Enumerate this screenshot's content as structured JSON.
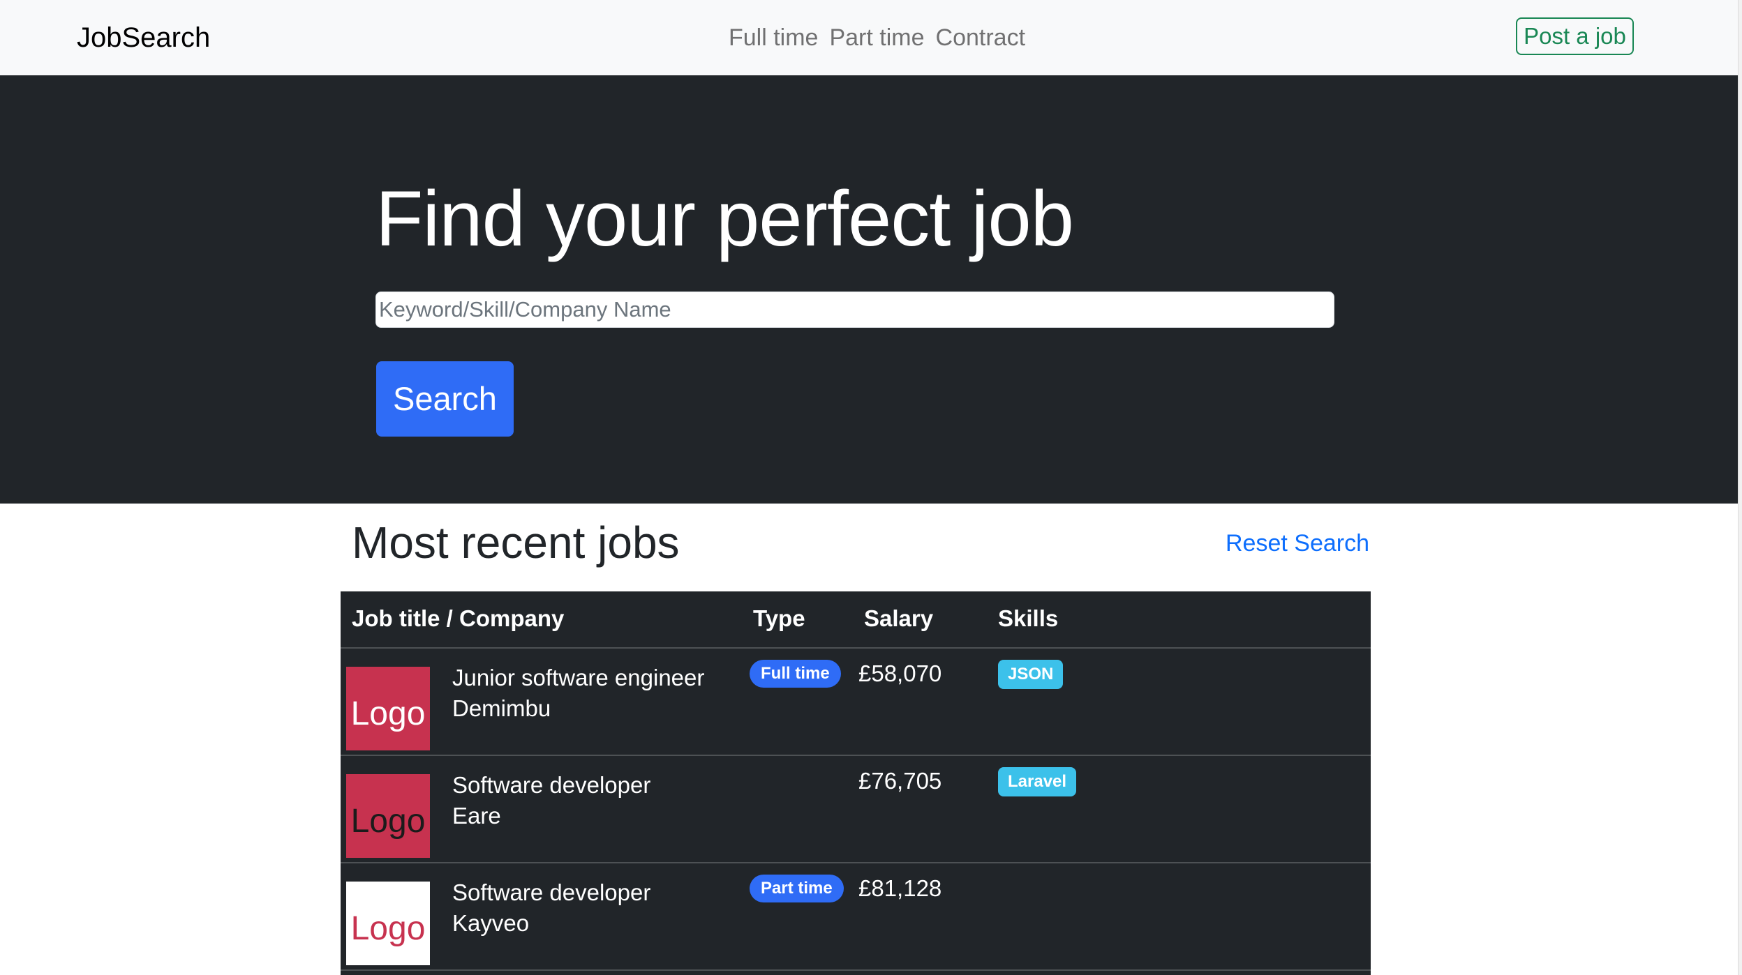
{
  "navbar": {
    "brand": "JobSearch",
    "links": [
      "Full time",
      "Part time",
      "Contract"
    ],
    "post_button": "Post a job"
  },
  "hero": {
    "title": "Find your perfect job",
    "search_placeholder": "Keyword/Skill/Company Name",
    "search_value": "",
    "search_button": "Search"
  },
  "recent": {
    "title": "Most recent jobs",
    "reset_link": "Reset Search",
    "columns": [
      "Job title / Company",
      "Type",
      "Salary",
      "Skills"
    ],
    "rows": [
      {
        "logo_text": "Logo",
        "title": "Junior software engineer",
        "company": "Demimbu",
        "type": "Full time",
        "salary": "£58,070",
        "skill": "JSON"
      },
      {
        "logo_text": "Logo",
        "title": "Software developer",
        "company": "Eare",
        "type": "",
        "salary": "£76,705",
        "skill": "Laravel"
      },
      {
        "logo_text": "Logo",
        "title": "Software developer",
        "company": "Kayveo",
        "type": "Part time",
        "salary": "£81,128",
        "skill": ""
      }
    ]
  },
  "colors": {
    "navbar_bg": "#f8f9fa",
    "hero_bg": "#212529",
    "primary": "#2f6cf6",
    "success": "#198754",
    "info": "#3cc1ea",
    "logo_red": "#c7324f"
  }
}
